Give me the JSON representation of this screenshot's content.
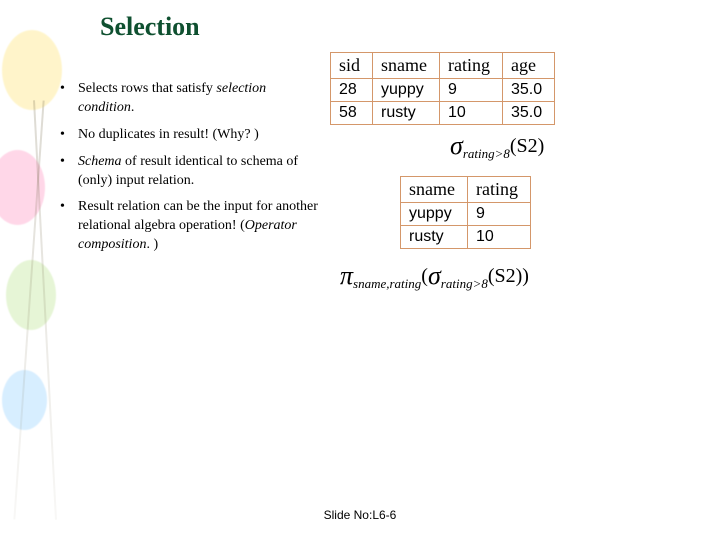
{
  "title": "Selection",
  "bullets": [
    {
      "pre": "Selects rows that satisfy ",
      "em": "selection condition",
      "post": "."
    },
    {
      "pre": "No duplicates in result!  (Why? )",
      "em": "",
      "post": ""
    },
    {
      "pre": "",
      "em": "Schema",
      "post": " of result identical to schema of (only) input relation."
    },
    {
      "pre": "Result relation can be the input for another relational algebra operation!  (",
      "em": "Operator composition",
      "post": ". )"
    }
  ],
  "table1": {
    "headers": [
      "sid",
      "sname",
      "rating",
      "age"
    ],
    "rows": [
      [
        "28",
        "yuppy",
        "9",
        "35.0"
      ],
      [
        "58",
        "rusty",
        "10",
        "35.0"
      ]
    ]
  },
  "formula1": {
    "op": "σ",
    "sub": "rating>8",
    "arg": "(S2)"
  },
  "table2": {
    "headers": [
      "sname",
      "rating"
    ],
    "rows": [
      [
        "yuppy",
        "9"
      ],
      [
        "rusty",
        "10"
      ]
    ]
  },
  "formula2": {
    "outer_op": "π",
    "outer_sub": "sname,rating",
    "inner_op": "σ",
    "inner_sub": "rating>8",
    "arg": "(S2)"
  },
  "footer": {
    "label": "Slide No:",
    "num": "L6-6"
  }
}
